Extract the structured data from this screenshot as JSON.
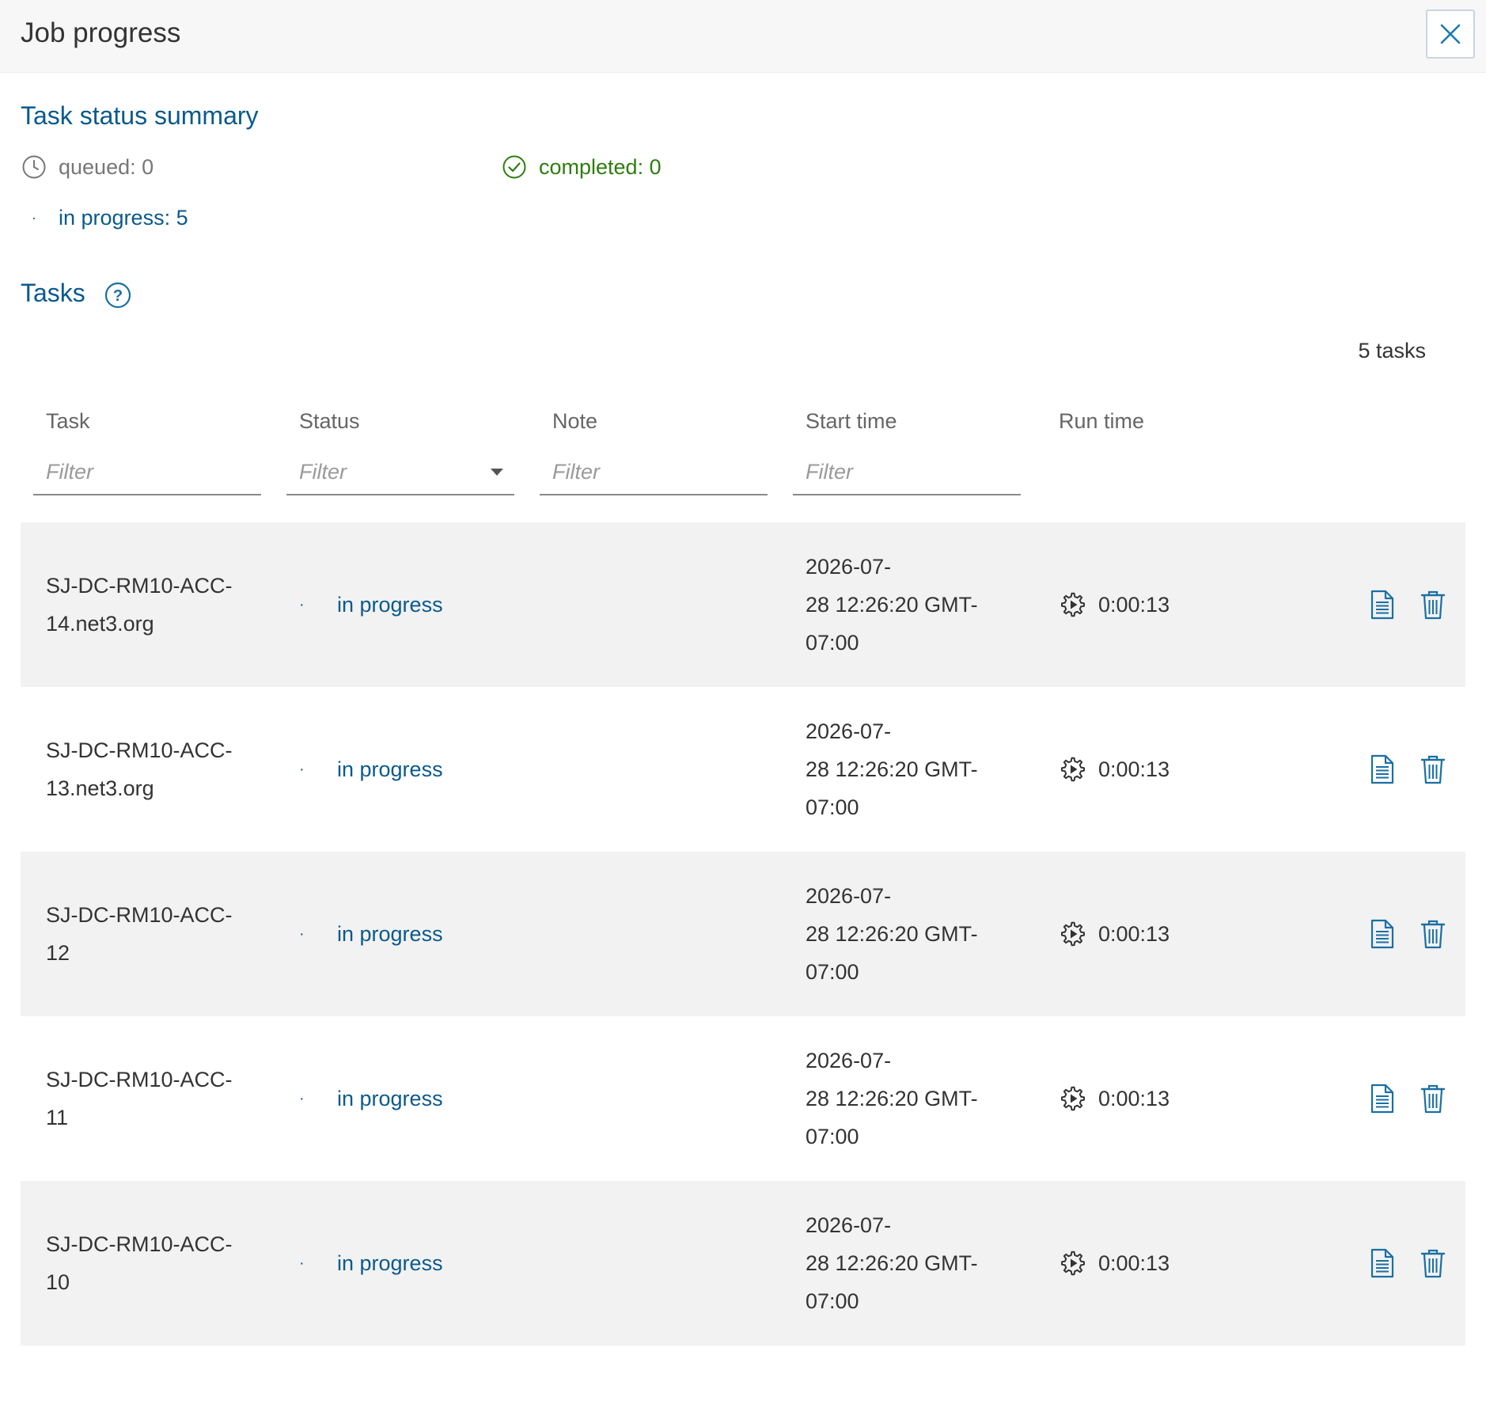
{
  "header": {
    "title": "Job progress",
    "close_icon": "close-icon"
  },
  "summary": {
    "title": "Task status summary",
    "queued_label": "queued: 0",
    "completed_label": "completed: 0",
    "in_progress_label": "in progress: 5",
    "colors": {
      "link": "#0a5a8c",
      "completed": "#2f7d0e",
      "muted": "#777777"
    }
  },
  "tasks_section": {
    "title": "Tasks",
    "help_icon": "help-icon",
    "count_label": "5 tasks",
    "columns": [
      "Task",
      "Status",
      "Note",
      "Start time",
      "Run time"
    ],
    "filter_placeholder": "Filter"
  },
  "rows": [
    {
      "task_line1": "SJ-DC-RM10-ACC-",
      "task_line2": "14.net3.org",
      "status": "in progress",
      "note": "",
      "start_line1": "2026-07-",
      "start_line2": "28  12:26:20 GMT-",
      "start_line3": "07:00",
      "run_time": "0:00:13"
    },
    {
      "task_line1": "SJ-DC-RM10-ACC-",
      "task_line2": "13.net3.org",
      "status": "in progress",
      "note": "",
      "start_line1": "2026-07-",
      "start_line2": "28  12:26:20 GMT-",
      "start_line3": "07:00",
      "run_time": "0:00:13"
    },
    {
      "task_line1": "SJ-DC-RM10-ACC-",
      "task_line2": "12",
      "status": "in progress",
      "note": "",
      "start_line1": "2026-07-",
      "start_line2": "28  12:26:20 GMT-",
      "start_line3": "07:00",
      "run_time": "0:00:13"
    },
    {
      "task_line1": "SJ-DC-RM10-ACC-",
      "task_line2": "11",
      "status": "in progress",
      "note": "",
      "start_line1": "2026-07-",
      "start_line2": "28  12:26:20 GMT-",
      "start_line3": "07:00",
      "run_time": "0:00:13"
    },
    {
      "task_line1": "SJ-DC-RM10-ACC-",
      "task_line2": "10",
      "status": "in progress",
      "note": "",
      "start_line1": "2026-07-",
      "start_line2": "28  12:26:20 GMT-",
      "start_line3": "07:00",
      "run_time": "0:00:13"
    }
  ]
}
